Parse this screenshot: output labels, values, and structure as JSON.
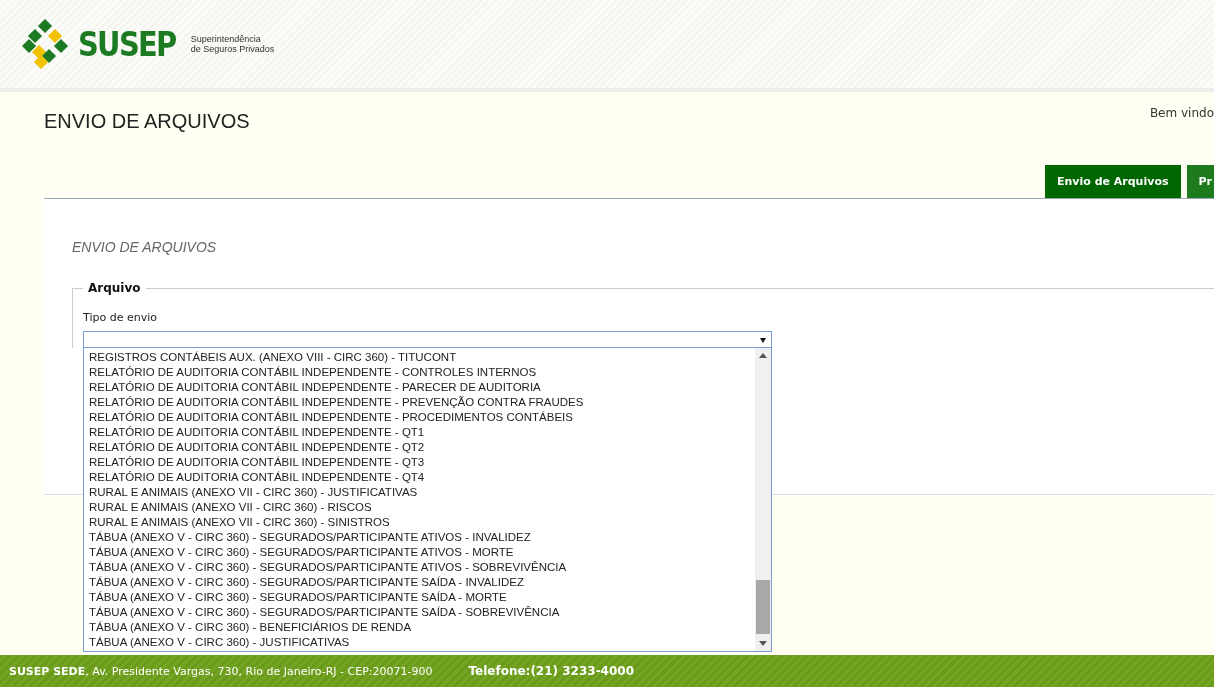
{
  "header": {
    "logo_text": "SUSEP",
    "logo_subtitle": [
      "Superintendência",
      "de Seguros Privados"
    ]
  },
  "page_title": "ENVIO DE ARQUIVOS",
  "welcome": "Bem vindo",
  "tabs": [
    {
      "label": "Envio de Arquivos",
      "selected": true
    },
    {
      "label": "Pr",
      "selected": false
    }
  ],
  "section_title": "ENVIO DE ARQUIVOS",
  "fieldset": {
    "legend": "Arquivo",
    "field_label": "Tipo de envio"
  },
  "dropdown_options": [
    "REGISTROS CONTÁBEIS AUX. (ANEXO VIII - CIRC 360) - TITUCONT",
    "RELATÓRIO DE AUDITORIA CONTÁBIL INDEPENDENTE - CONTROLES INTERNOS",
    "RELATÓRIO DE AUDITORIA CONTÁBIL INDEPENDENTE - PARECER DE AUDITORIA",
    "RELATÓRIO DE AUDITORIA CONTÁBIL INDEPENDENTE - PREVENÇÃO CONTRA FRAUDES",
    "RELATÓRIO DE AUDITORIA CONTÁBIL INDEPENDENTE - PROCEDIMENTOS CONTÁBEIS",
    "RELATÓRIO DE AUDITORIA CONTÁBIL INDEPENDENTE - QT1",
    "RELATÓRIO DE AUDITORIA CONTÁBIL INDEPENDENTE - QT2",
    "RELATÓRIO DE AUDITORIA CONTÁBIL INDEPENDENTE - QT3",
    "RELATÓRIO DE AUDITORIA CONTÁBIL INDEPENDENTE - QT4",
    "RURAL E ANIMAIS (ANEXO VII - CIRC 360) - JUSTIFICATIVAS",
    "RURAL E ANIMAIS (ANEXO VII - CIRC 360) - RISCOS",
    "RURAL E ANIMAIS (ANEXO VII - CIRC 360) - SINISTROS",
    "TÁBUA (ANEXO V - CIRC 360) - SEGURADOS/PARTICIPANTE ATIVOS - INVALIDEZ",
    "TÁBUA (ANEXO V - CIRC 360) - SEGURADOS/PARTICIPANTE ATIVOS - MORTE",
    "TÁBUA (ANEXO V - CIRC 360) - SEGURADOS/PARTICIPANTE ATIVOS - SOBREVIVÊNCIA",
    "TÁBUA (ANEXO V - CIRC 360) - SEGURADOS/PARTICIPANTE SAÍDA - INVALIDEZ",
    "TÁBUA (ANEXO V - CIRC 360) - SEGURADOS/PARTICIPANTE SAÍDA - MORTE",
    "TÁBUA (ANEXO V - CIRC 360) - SEGURADOS/PARTICIPANTE SAÍDA - SOBREVIVÊNCIA",
    "TÁBUA (ANEXO V - CIRC 360) - BENEFICIÁRIOS DE RENDA",
    "TÁBUA (ANEXO V - CIRC 360) - JUSTIFICATIVAS"
  ],
  "footer": {
    "address": "**SUSEP SEDE**, Av. Presidente Vargas, 730, Rio de Janeiro-RJ  -  CEP:20071-900",
    "phone": "Telefone:(21) 3233-4000"
  }
}
